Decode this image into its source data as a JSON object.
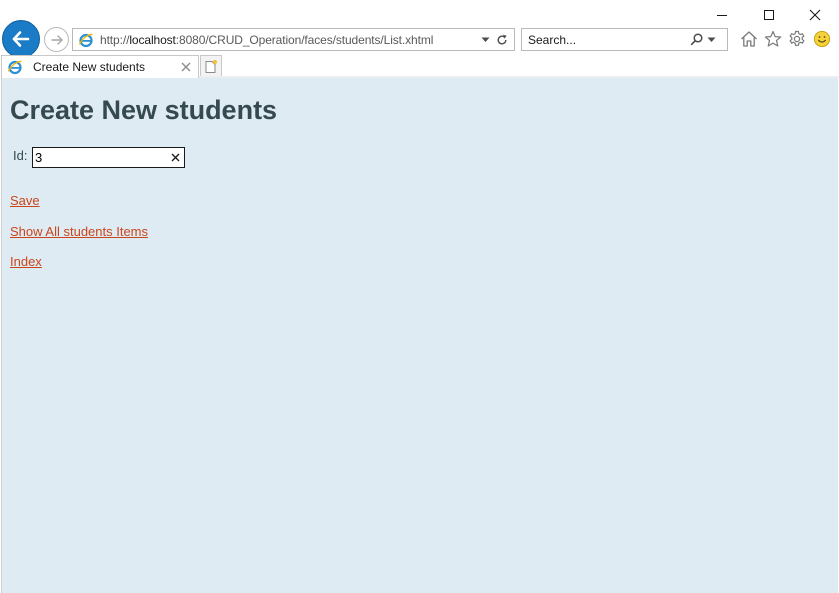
{
  "window": {
    "controls": [
      "minimize",
      "maximize",
      "close"
    ]
  },
  "toolbar": {
    "back_icon": "back-arrow-icon",
    "forward_icon": "forward-arrow-icon",
    "address": {
      "scheme": "http://",
      "host": "localhost",
      "rest": ":8080/CRUD_Operation/faces/students/List.xhtml"
    },
    "search": {
      "placeholder": "Search..."
    },
    "icons": [
      "home-icon",
      "favorites-star-icon",
      "settings-gear-icon",
      "feedback-smiley-icon"
    ]
  },
  "tabs": [
    {
      "label": "Create New students",
      "active": true
    }
  ],
  "page": {
    "title": "Create New students",
    "id_label": "Id:",
    "id_value": "3",
    "links": {
      "save": "Save",
      "show_all": "Show All students Items",
      "index": "Index"
    }
  },
  "colors": {
    "page_background": "#dfebf2",
    "heading": "#344a50",
    "link": "#c9461c",
    "back_button": "#1a7bc6"
  }
}
